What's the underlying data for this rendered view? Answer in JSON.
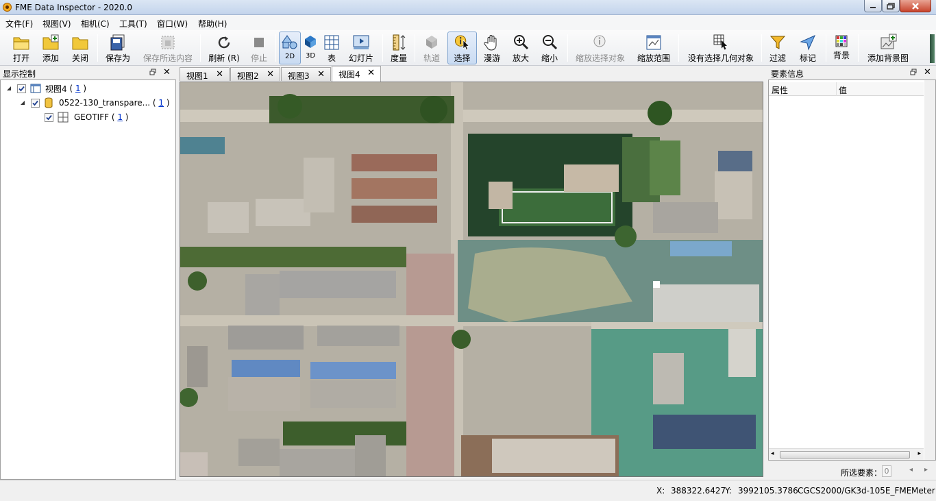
{
  "window": {
    "title": "FME Data Inspector - 2020.0"
  },
  "menu": [
    "文件(F)",
    "视图(V)",
    "相机(C)",
    "工具(T)",
    "窗口(W)",
    "帮助(H)"
  ],
  "toolbar": {
    "open": "打开",
    "add": "添加",
    "close": "关闭",
    "save_as": "保存为",
    "save_selected": "保存所选内容",
    "refresh": "刷新 (R)",
    "stop": "停止",
    "mode_2d": "2D",
    "mode_3d": "3D",
    "table": "表",
    "slideshow": "幻灯片",
    "measure": "度量",
    "orbit": "轨道",
    "select": "选择",
    "pan": "漫游",
    "zoom_in": "放大",
    "zoom_out": "缩小",
    "zoom_selected": "缩放选择对象",
    "zoom_extent": "缩放范围",
    "no_geometry": "没有选择几何对象",
    "filter": "过滤",
    "mark": "标记",
    "background": "背景",
    "add_background": "添加背景图"
  },
  "display_panel": {
    "title": "显示控制",
    "tree": [
      {
        "label": "视图4",
        "count": "1"
      },
      {
        "label": "0522-130_transpare...",
        "count": "1"
      },
      {
        "label": "GEOTIFF",
        "count": "1"
      }
    ]
  },
  "tabs": [
    "视图1",
    "视图2",
    "视图3",
    "视图4"
  ],
  "feature_panel": {
    "title": "要素信息",
    "columns": [
      "属性",
      "值"
    ],
    "selected_label": "所选要素：",
    "selected_count": "0"
  },
  "status": {
    "x_label": "X:",
    "x_value": "388322.6427",
    "y_label": "Y:",
    "y_value": "3992105.3786",
    "crs": "CGCS2000/GK3d-105E_FME",
    "unit": "Meter"
  },
  "colors": {
    "title_gradient": "#c3d4ec",
    "link_blue": "#0033cc",
    "active_tool": "#c9dbf2"
  }
}
